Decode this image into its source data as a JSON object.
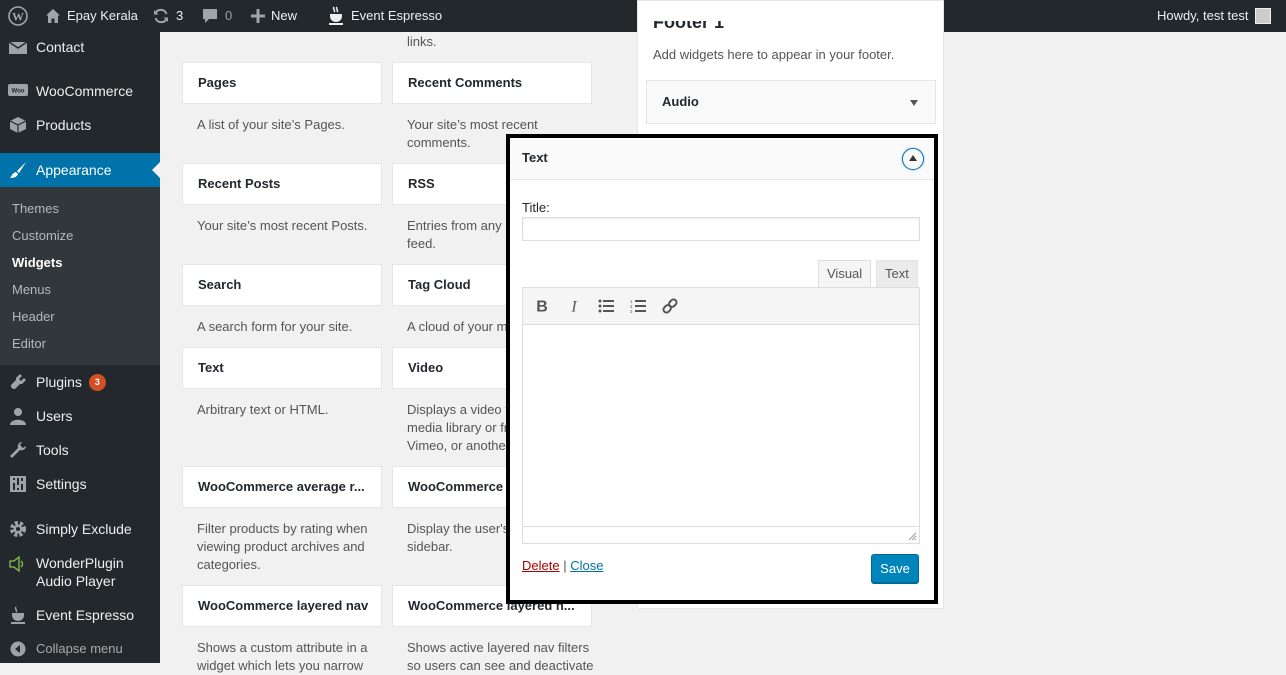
{
  "adminbar": {
    "site_name": "Epay Kerala",
    "updates_count": "3",
    "comments_count": "0",
    "new_label": "New",
    "plugin_label": "Event Espresso",
    "greeting": "Howdy, test test"
  },
  "sidebar": {
    "contact": "Contact",
    "woocommerce": "WooCommerce",
    "products": "Products",
    "appearance": "Appearance",
    "submenu": {
      "themes": "Themes",
      "customize": "Customize",
      "widgets": "Widgets",
      "menus": "Menus",
      "header": "Header",
      "editor": "Editor"
    },
    "plugins": "Plugins",
    "plugins_badge": "3",
    "users": "Users",
    "tools": "Tools",
    "settings": "Settings",
    "simply_exclude": "Simply Exclude",
    "wonderplugin_line1": "WonderPlugin",
    "wonderplugin_line2": "Audio Player",
    "event_espresso": "Event Espresso",
    "collapse": "Collapse menu",
    "woo_icon_text": "Woo"
  },
  "widgets": {
    "top_fragment": "links.",
    "pages": {
      "title": "Pages",
      "desc": "A list of your site’s Pages."
    },
    "recent_comments": {
      "title": "Recent Comments",
      "desc1": "Your site’s most recent",
      "desc2": "comments."
    },
    "recent_posts": {
      "title": "Recent Posts",
      "desc": "Your site’s most recent Posts."
    },
    "rss": {
      "title": "RSS",
      "desc1": "Entries from any R",
      "desc2": "feed."
    },
    "search": {
      "title": "Search",
      "desc": "A search form for your site."
    },
    "tag_cloud": {
      "title": "Tag Cloud",
      "desc": "A cloud of your mo"
    },
    "text": {
      "title": "Text",
      "desc": "Arbitrary text or HTML."
    },
    "video": {
      "title": "Video",
      "desc1": "Displays a video fr",
      "desc2": "media library or fr",
      "desc3": "Vimeo, or another"
    },
    "woo_avg": {
      "title": "WooCommerce average r...",
      "desc1": "Filter products by rating when",
      "desc2": "viewing product archives and",
      "desc3": "categories."
    },
    "woo_cart": {
      "title": "WooCommerce c",
      "desc1": "Display the user's c",
      "desc2": "sidebar."
    },
    "woo_layered": {
      "title": "WooCommerce layered nav",
      "desc1": "Shows a custom attribute in a",
      "desc2": "widget which lets you narrow"
    },
    "woo_layered_filters": {
      "title": "WooCommerce layered n...",
      "desc1": "Shows active layered nav filters",
      "desc2": "so users can see and deactivate"
    }
  },
  "footer_sidebar": {
    "heading": "Footer 1",
    "description": "Add widgets here to appear in your footer.",
    "audio_widget": "Audio"
  },
  "text_widget": {
    "header": "Text",
    "title_label": "Title:",
    "title_value": "",
    "tab_visual": "Visual",
    "tab_text": "Text",
    "delete": "Delete",
    "separator": "|",
    "close": "Close",
    "save": "Save"
  },
  "colors": {
    "admin_dark": "#23282d",
    "accent": "#0073aa",
    "button": "#0085ba",
    "badge": "#d54e21",
    "delete": "#aa0000"
  }
}
